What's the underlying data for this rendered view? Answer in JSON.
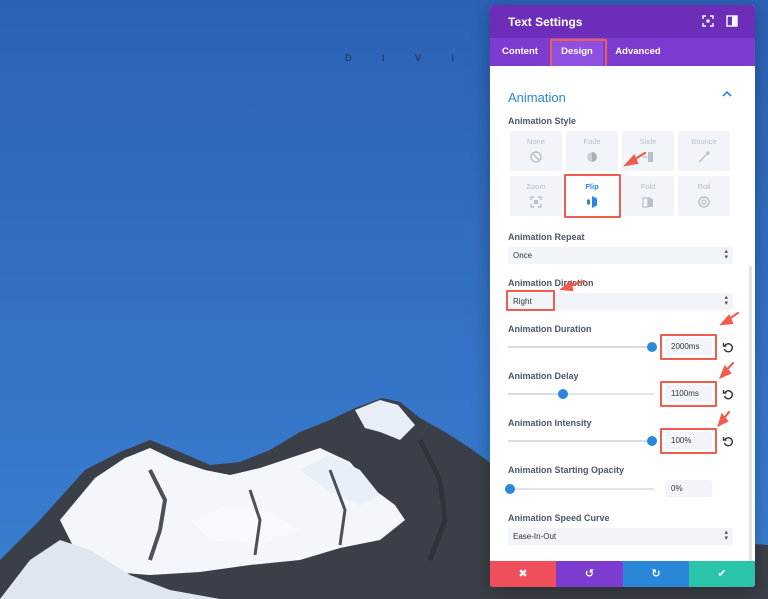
{
  "brand": {
    "text": "D I V I"
  },
  "panel": {
    "title": "Text Settings",
    "header_icons": [
      "fullscreen-icon",
      "sidebar-toggle-icon"
    ],
    "tabs": [
      {
        "label": "Content",
        "active": false
      },
      {
        "label": "Design",
        "active": true
      },
      {
        "label": "Advanced",
        "active": false
      }
    ],
    "section": {
      "title": "Animation",
      "expanded": true
    },
    "animation_style": {
      "label": "Animation Style",
      "options": [
        {
          "label": "None",
          "icon": "none-icon",
          "selected": false
        },
        {
          "label": "Fade",
          "icon": "fade-icon",
          "selected": false
        },
        {
          "label": "Slide",
          "icon": "slide-icon",
          "selected": false
        },
        {
          "label": "Bounce",
          "icon": "bounce-icon",
          "selected": false
        },
        {
          "label": "Zoom",
          "icon": "zoom-icon",
          "selected": false
        },
        {
          "label": "Flip",
          "icon": "flip-icon",
          "selected": true
        },
        {
          "label": "Fold",
          "icon": "fold-icon",
          "selected": false
        },
        {
          "label": "Roll",
          "icon": "roll-icon",
          "selected": false
        }
      ]
    },
    "animation_repeat": {
      "label": "Animation Repeat",
      "value": "Once"
    },
    "animation_direction": {
      "label": "Animation Direction",
      "value": "Right"
    },
    "animation_duration": {
      "label": "Animation Duration",
      "value": "2000ms",
      "level": 1.0
    },
    "animation_delay": {
      "label": "Animation Delay",
      "value": "1100ms",
      "level": 0.37
    },
    "animation_intensity": {
      "label": "Animation Intensity",
      "value": "100%",
      "level": 1.0
    },
    "animation_opacity": {
      "label": "Animation Starting Opacity",
      "value": "0%",
      "level": 0.0
    },
    "animation_speed_curve": {
      "label": "Animation Speed Curve",
      "value": "Ease-In-Out"
    },
    "footer": {
      "cancel": "✖",
      "undo": "↺",
      "redo": "↻",
      "save": "✔"
    }
  },
  "colors": {
    "header": "#6c2eb9",
    "tabs": "#7e3bd0",
    "accent": "#2b87da",
    "annotation": "#f05d4e",
    "btn_cancel": "#ef4f5a",
    "btn_undo": "#7e3bd0",
    "btn_redo": "#2b87da",
    "btn_save": "#29c4a9"
  }
}
